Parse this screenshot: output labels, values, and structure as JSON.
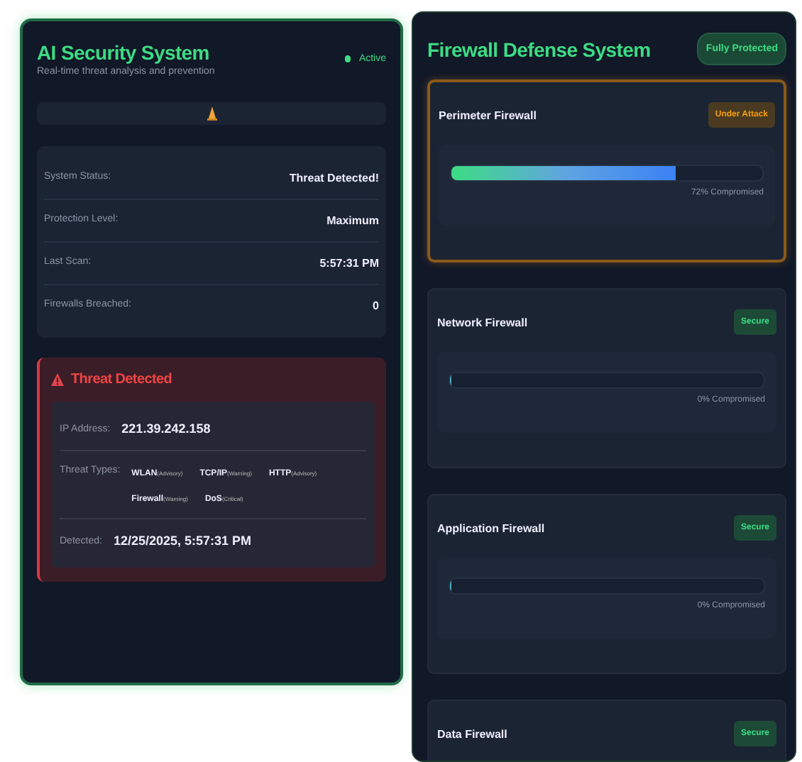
{
  "ai_panel": {
    "title": "AI Security System",
    "subtitle": "Real-time threat analysis and prevention",
    "status": {
      "label": "Active",
      "on": true
    },
    "stats": [
      {
        "label": "System Status:",
        "value": "Threat Detected!"
      },
      {
        "label": "Protection Level:",
        "value": "Maximum"
      },
      {
        "label": "Last Scan:",
        "value": "5:57:31 PM"
      },
      {
        "label": "Firewalls Breached:",
        "value": "0"
      }
    ],
    "threat": {
      "title": "Threat Detected",
      "ip_label": "IP Address:",
      "ip": "221.39.242.158",
      "types_label": "Threat Types:",
      "types": [
        {
          "name": "WLAN",
          "severity": "(Advisory)"
        },
        {
          "name": "TCP/IP",
          "severity": "(Warning)"
        },
        {
          "name": "HTTP",
          "severity": "(Advisory)"
        },
        {
          "name": "Firewall",
          "severity": "(Warning)"
        },
        {
          "name": "DoS",
          "severity": "(Critical)"
        }
      ],
      "detected_label": "Detected:",
      "detected": "12/25/2025, 5:57:31 PM"
    }
  },
  "firewall_panel": {
    "title": "Firewall Defense System",
    "badge": "Fully Protected",
    "firewalls": [
      {
        "name": "Perimeter Firewall",
        "status": "Under Attack",
        "kind": "attack",
        "level": 0.72,
        "reading": "72% Compromised"
      },
      {
        "name": "Network Firewall",
        "status": "Secure",
        "kind": "secure",
        "level": 0,
        "reading": "0% Compromised"
      },
      {
        "name": "Application Firewall",
        "status": "Secure",
        "kind": "secure",
        "level": 0,
        "reading": "0% Compromised"
      },
      {
        "name": "Data Firewall",
        "status": "Secure",
        "kind": "secure"
      }
    ]
  }
}
